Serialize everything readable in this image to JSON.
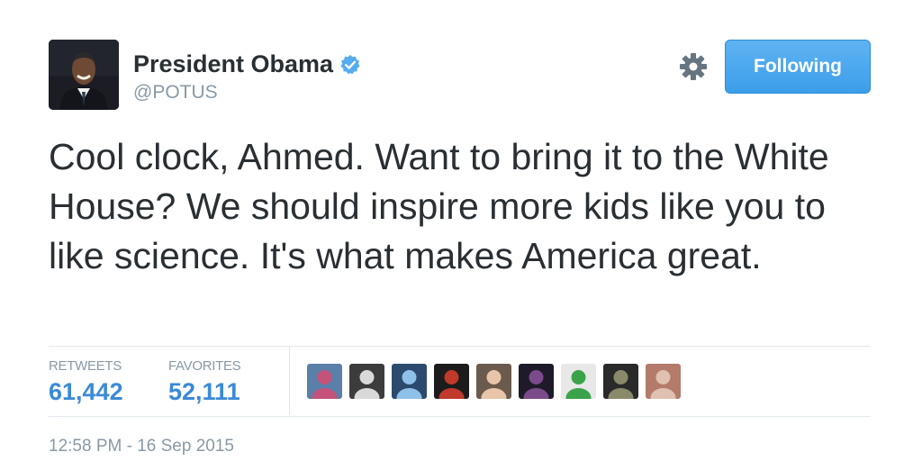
{
  "user": {
    "display_name": "President Obama",
    "handle": "@POTUS",
    "verified": true
  },
  "actions": {
    "follow_label": "Following"
  },
  "tweet": {
    "text": "Cool clock, Ahmed. Want to bring it to the White House? We should inspire more kids like you to like science. It's what makes America great.",
    "timestamp": "12:58 PM - 16 Sep 2015"
  },
  "stats": {
    "retweets_label": "RETWEETS",
    "retweets_count": "61,442",
    "favorites_label": "FAVORITES",
    "favorites_count": "52,111"
  },
  "colors": {
    "accent": "#55acee",
    "count_blue": "#3b8ad6",
    "muted": "#8899a6",
    "text": "#292f33",
    "divider": "#e1e8ed"
  },
  "icons": [
    "verified-badge-icon",
    "gear-icon"
  ],
  "favoriter_avatars": [
    {
      "name": "favoriter-avatar-1",
      "bg": "#5a7fa8",
      "fg": "#c4527a"
    },
    {
      "name": "favoriter-avatar-2",
      "bg": "#3c3c3c",
      "fg": "#d9d9d9"
    },
    {
      "name": "favoriter-avatar-3",
      "bg": "#2c4a6e",
      "fg": "#8fc0e8"
    },
    {
      "name": "favoriter-avatar-4",
      "bg": "#1c1c1c",
      "fg": "#c0392b"
    },
    {
      "name": "favoriter-avatar-5",
      "bg": "#6b5a4e",
      "fg": "#e8c4a8"
    },
    {
      "name": "favoriter-avatar-6",
      "bg": "#1f1a2a",
      "fg": "#7a4a8a"
    },
    {
      "name": "favoriter-avatar-7",
      "bg": "#e8e8e8",
      "fg": "#3aa34a"
    },
    {
      "name": "favoriter-avatar-8",
      "bg": "#2a2a2a",
      "fg": "#8a8a6a"
    },
    {
      "name": "favoriter-avatar-9",
      "bg": "#b47a6a",
      "fg": "#e0c0b0"
    }
  ]
}
